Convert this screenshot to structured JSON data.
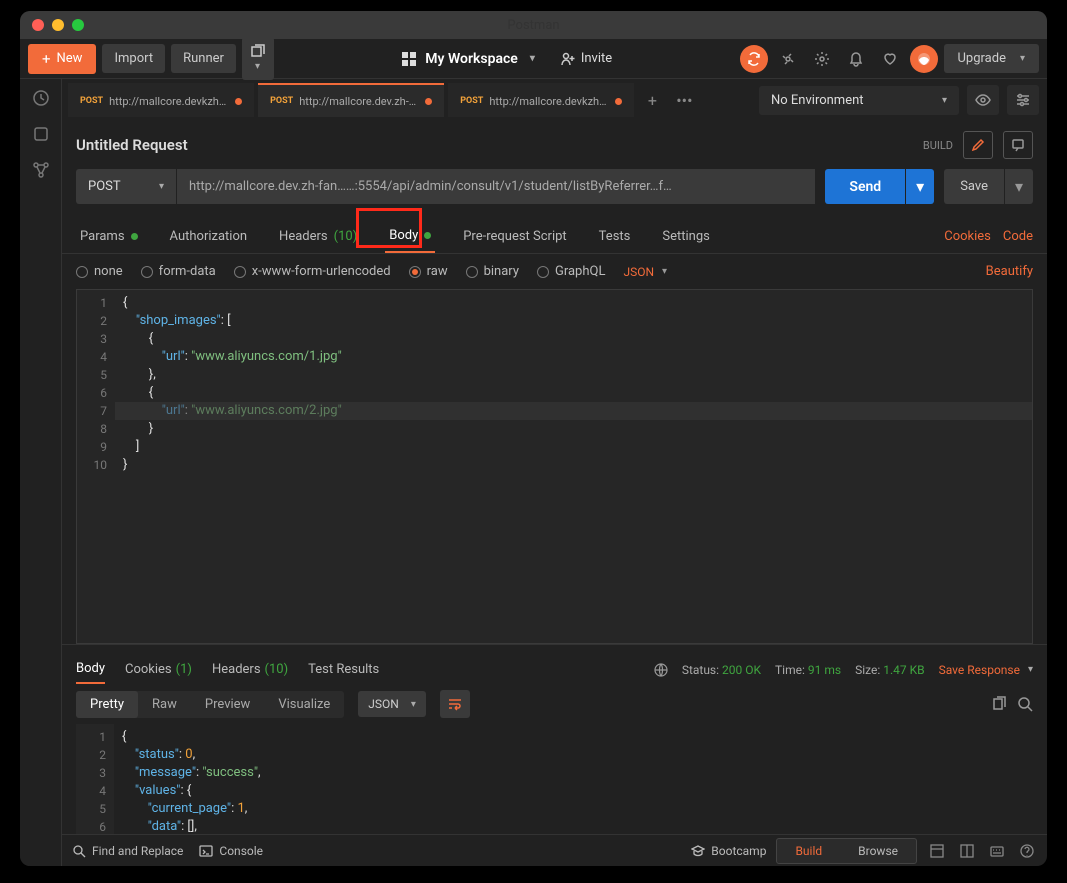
{
  "window": {
    "title": "Postman"
  },
  "toolbar": {
    "new": "New",
    "import": "Import",
    "runner": "Runner",
    "workspace": "My Workspace",
    "invite": "Invite",
    "upgrade": "Upgrade"
  },
  "tabs": [
    {
      "method": "POST",
      "title": "http://mallcore.devkzhafun…"
    },
    {
      "method": "POST",
      "title": "http://mallcore.dev.zh-fan…"
    },
    {
      "method": "POST",
      "title": "http://mallcore.devkzhafun…"
    }
  ],
  "environment": {
    "selected": "No Environment"
  },
  "request": {
    "name": "Untitled Request",
    "build_label": "BUILD",
    "method": "POST",
    "url": "http://mallcore.dev.zh-fan……:5554/api/admin/consult/v1/student/listByReferrer…f…",
    "send": "Send",
    "save": "Save"
  },
  "req_tabs": {
    "params": "Params",
    "authorization": "Authorization",
    "headers": "Headers",
    "headers_count": "(10)",
    "body": "Body",
    "prerequest": "Pre-request Script",
    "tests": "Tests",
    "settings": "Settings",
    "cookies": "Cookies",
    "code": "Code"
  },
  "body_types": {
    "none": "none",
    "form_data": "form-data",
    "urlencoded": "x-www-form-urlencoded",
    "raw": "raw",
    "binary": "binary",
    "graphql": "GraphQL",
    "format": "JSON",
    "beautify": "Beautify"
  },
  "body_code": {
    "lines": [
      "1",
      "2",
      "3",
      "4",
      "5",
      "6",
      "7",
      "8",
      "9",
      "10"
    ],
    "key_shop_images": "\"shop_images\"",
    "key_url": "\"url\"",
    "val_url1": "\"www.aliyuncs.com/1.jpg\"",
    "val_url2": "\"www.aliyuncs.com/2.jpg\""
  },
  "response": {
    "tabs": {
      "body": "Body",
      "cookies": "Cookies",
      "cookies_count": "(1)",
      "headers": "Headers",
      "headers_count": "(10)",
      "test_results": "Test Results"
    },
    "status_label": "Status:",
    "status_val": "200 OK",
    "time_label": "Time:",
    "time_val": "91 ms",
    "size_label": "Size:",
    "size_val": "1.47 KB",
    "save": "Save Response",
    "viewer": {
      "pretty": "Pretty",
      "raw": "Raw",
      "preview": "Preview",
      "visualize": "Visualize",
      "format": "JSON"
    },
    "code_lines": [
      "1",
      "2",
      "3",
      "4",
      "5",
      "6"
    ],
    "keys": {
      "status": "\"status\"",
      "message": "\"message\"",
      "values": "\"values\"",
      "current_page": "\"current_page\"",
      "data": "\"data\""
    },
    "vals": {
      "status": "0",
      "message": "\"success\"",
      "current_page": "1"
    }
  },
  "statusbar": {
    "find": "Find and Replace",
    "console": "Console",
    "bootcamp": "Bootcamp",
    "build": "Build",
    "browse": "Browse"
  }
}
